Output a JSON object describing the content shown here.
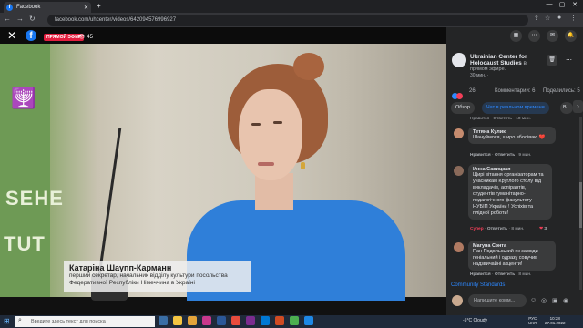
{
  "browser": {
    "tab_title": "Facebook",
    "tab_favicon": "facebook-favicon",
    "url": "facebook.com/uhcenter/videos/642094576996927",
    "new_tab_label": "+"
  },
  "video": {
    "live_badge": "ПРЯМОЙ ЭФИР",
    "viewer_count": "45",
    "lower_third_name": "Катаріна Шаупп-Карманн",
    "lower_third_role_line1": "перший секретар, начальник відділу культури посольства",
    "lower_third_role_line2": "Федеративної Республіки Німеччина в Україні",
    "backdrop_text_1": "SЕНЕ",
    "backdrop_text_2": "TUT"
  },
  "post": {
    "page_name": "Ukrainian Center for Holocaust Studies",
    "page_name_suffix": "в",
    "sub": "прямом эфире.",
    "time": "30 мин. ·",
    "reactions_count": "26",
    "comments_label": "Комментарии: 6",
    "shares_label": "Поделились: 5"
  },
  "tabs": [
    "Обзор",
    "Чат в реальном времени",
    "В"
  ],
  "comments": [
    {
      "name": "Тетяна Кулик",
      "text": "Шануймося, щиро вболіваю ❤️",
      "meta_like": "Нравится",
      "meta_reply": "Ответить",
      "meta_time": "9 мин."
    },
    {
      "name": "Инна Савицкая",
      "text": "Щирі вітання організаторам та учасникам Круглого столу від викладачів, аспірантів, студентів гуманітарно-педагогічного факультету НУБІП України ! Успіхів та плідної роботи!",
      "meta_like": "Супер",
      "meta_reply": "Ответить",
      "meta_time": "8 мин.",
      "react_count": "3"
    },
    {
      "name": "Магуна Сэнта",
      "text": "Пан Подольський як завжди геніальний і одразу совучив надзвичайні акценти!",
      "meta_like": "Нравится",
      "meta_reply": "Ответить",
      "meta_time": "8 мин."
    }
  ],
  "prev_comment_meta": "Нравится · Ответить · 10 мин.",
  "community_standards": "Community Standards",
  "compose_placeholder": "Напишите комм...",
  "taskbar": {
    "search_placeholder": "Введите здесь текст для поиска",
    "weather": "-5°C  Cloudy",
    "lang_line1": "РУС",
    "lang_line2": "UKR",
    "time": "10:28",
    "date": "27.01.2022"
  },
  "colors": {
    "facebook_blue": "#1877f2",
    "live_red": "#e41e3f",
    "panel_bg": "#242526",
    "bubble_bg": "#3a3b3c"
  }
}
